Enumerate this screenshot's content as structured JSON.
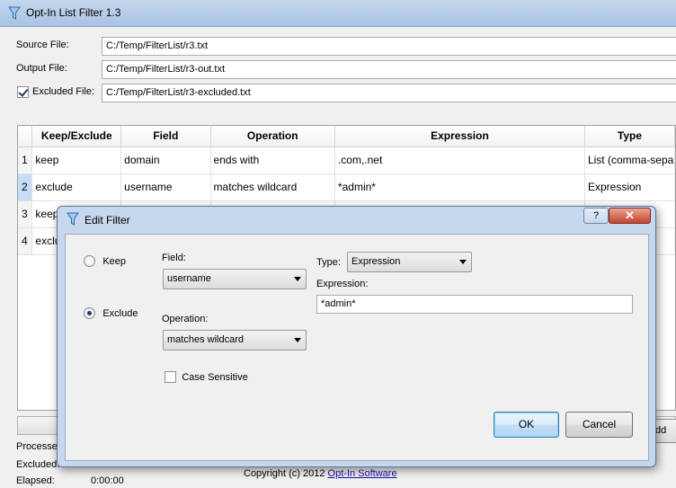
{
  "window": {
    "title": "Opt-In List Filter 1.3"
  },
  "files": {
    "source_label": "Source File:",
    "source_value": "C:/Temp/FilterList/r3.txt",
    "output_label": "Output File:",
    "output_value": "C:/Temp/FilterList/r3-out.txt",
    "excluded_label": "Excluded File:",
    "excluded_value": "C:/Temp/FilterList/r3-excluded.txt",
    "excluded_checked": true
  },
  "grid": {
    "columns": [
      "Keep/Exclude",
      "Field",
      "Operation",
      "Expression",
      "Type"
    ],
    "rows": [
      {
        "num": "1",
        "keep": "keep",
        "field": "domain",
        "operation": "ends with",
        "expression": ".com,.net",
        "type": "List (comma-sepa"
      },
      {
        "num": "2",
        "keep": "exclude",
        "field": "username",
        "operation": "matches wildcard",
        "expression": "*admin*",
        "type": "Expression"
      },
      {
        "num": "3",
        "keep": "keep",
        "field": "",
        "operation": "",
        "expression": "",
        "type": ""
      },
      {
        "num": "4",
        "keep": "exclu",
        "field": "",
        "operation": "",
        "expression": "",
        "type": ""
      }
    ]
  },
  "status": {
    "processed_label": "Processed",
    "excluded_label": "Excluded:",
    "elapsed_label": "Elapsed:",
    "elapsed_value": "0:00:00",
    "copyright_text": "Copyright (c) 2012 ",
    "copyright_link": "Opt-In Software",
    "add_label": "dd"
  },
  "dialog": {
    "title": "Edit Filter",
    "help": "?",
    "close": "✕",
    "keep_label": "Keep",
    "exclude_label": "Exclude",
    "selected_mode": "exclude",
    "field_label": "Field:",
    "field_value": "username",
    "operation_label": "Operation:",
    "operation_value": "matches wildcard",
    "case_sensitive_label": "Case Sensitive",
    "type_label": "Type:",
    "type_value": "Expression",
    "expression_label": "Expression:",
    "expression_value": "*admin*",
    "ok": "OK",
    "cancel": "Cancel"
  },
  "colors": {
    "accent": "#3c7fb1",
    "close_red": "#c7432b"
  }
}
